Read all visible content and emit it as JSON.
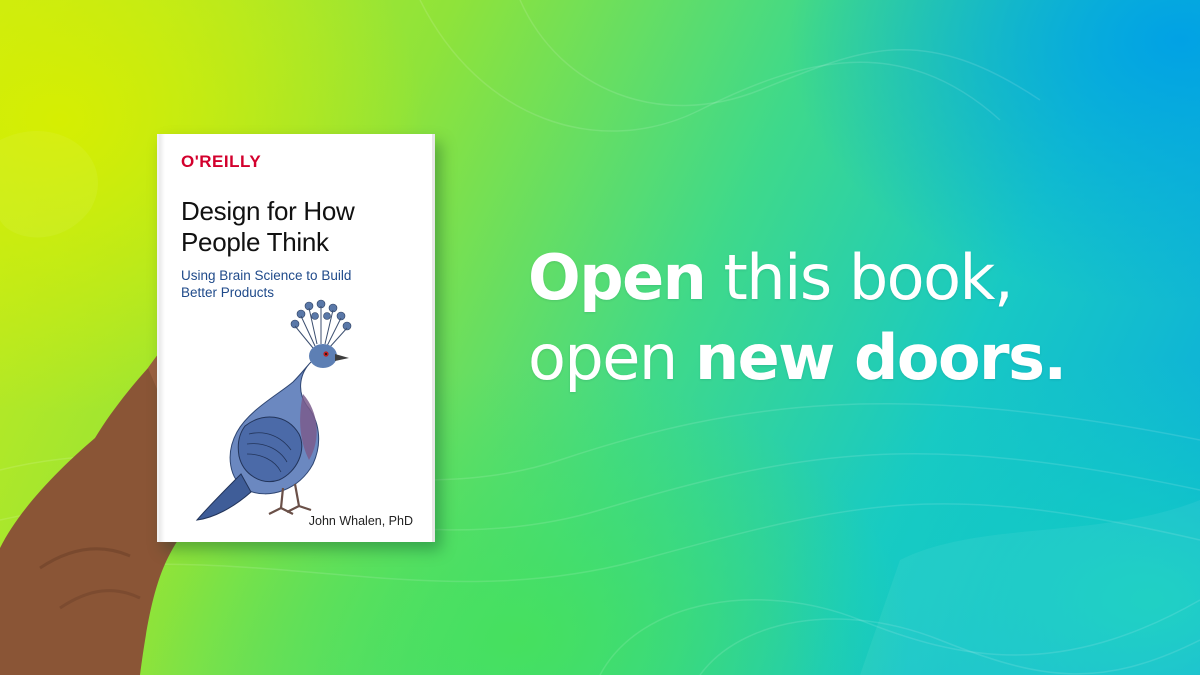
{
  "book": {
    "publisher": "O'REILLY",
    "title_line1": "Design for How",
    "title_line2": "People Think",
    "subtitle_line1": "Using Brain Science to Build",
    "subtitle_line2": "Better Products",
    "author": "John Whalen, PhD"
  },
  "tagline": {
    "line1_bold": "Open",
    "line1_rest": " this book,",
    "line2_light": "open ",
    "line2_bold": "new doors."
  },
  "colors": {
    "publisher_red": "#d3002d",
    "subtitle_blue": "#1f4a8a",
    "tagline_white": "#ffffff"
  },
  "icons": {
    "illustration": "victoria-crowned-pigeon-illustration",
    "hand": "hand-holding-book"
  }
}
